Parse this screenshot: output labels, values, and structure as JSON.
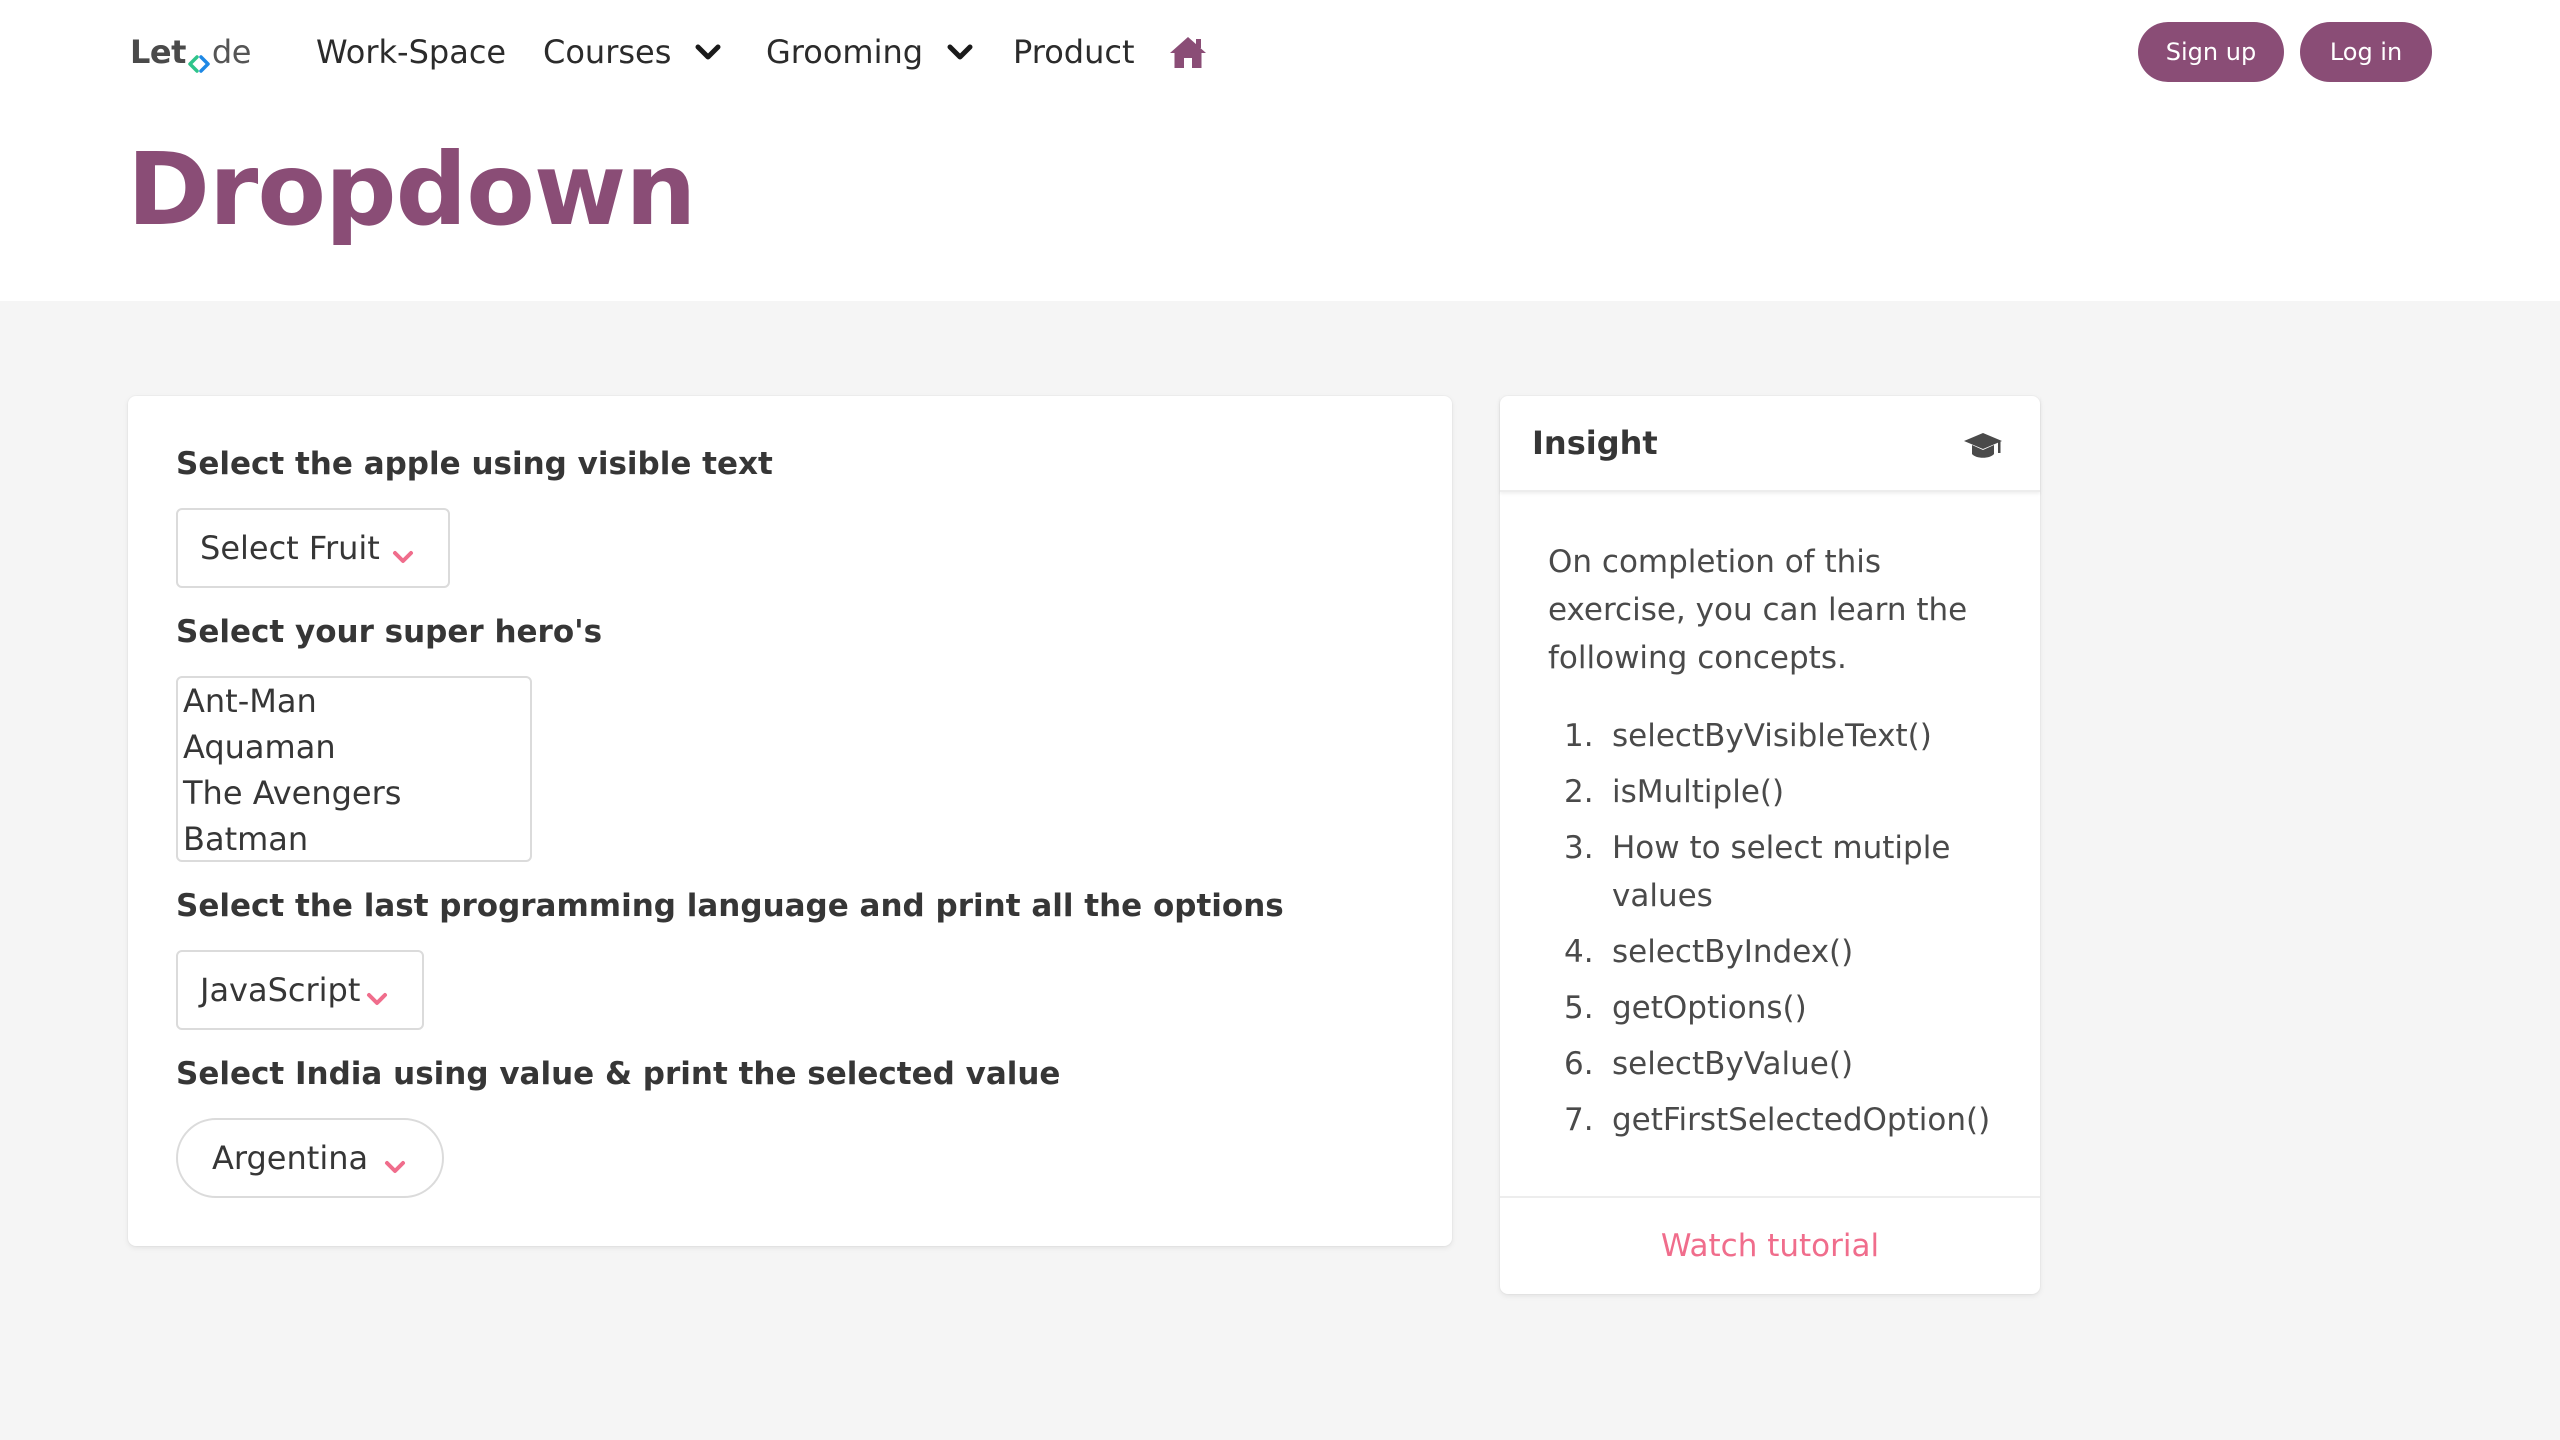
{
  "brand": {
    "bold": "Let",
    "rest": "de"
  },
  "nav": {
    "workspace": "Work-Space",
    "courses": "Courses",
    "grooming": "Grooming",
    "product": "Product"
  },
  "auth": {
    "signup": "Sign up",
    "login": "Log in"
  },
  "page": {
    "title": "Dropdown"
  },
  "form": {
    "fruit_label": "Select the apple using visible text",
    "fruit_value": "Select Fruit",
    "hero_label": "Select your super hero's",
    "hero_options": [
      "Ant-Man",
      "Aquaman",
      "The Avengers",
      "Batman"
    ],
    "lang_label": "Select the last programming language and print all the options",
    "lang_value": "JavaScript",
    "country_label": "Select India using value & print the selected value",
    "country_value": "Argentina"
  },
  "insight": {
    "title": "Insight",
    "description": "On completion of this exercise, you can learn the following concepts.",
    "concepts": [
      "selectByVisibleText()",
      "isMultiple()",
      "How to select mutiple values",
      "selectByIndex()",
      "getOptions()",
      "selectByValue()",
      "getFirstSelectedOption()"
    ],
    "watch_label": "Watch tutorial"
  },
  "colors": {
    "brand_purple": "#8a4d76",
    "accent_pink": "#f06d8c",
    "logo_green": "#2ec48a",
    "logo_blue": "#1e88e5"
  },
  "icons": {
    "home": "home-icon",
    "cap": "graduation-cap-icon",
    "dropdown": "chevron-down-icon"
  }
}
